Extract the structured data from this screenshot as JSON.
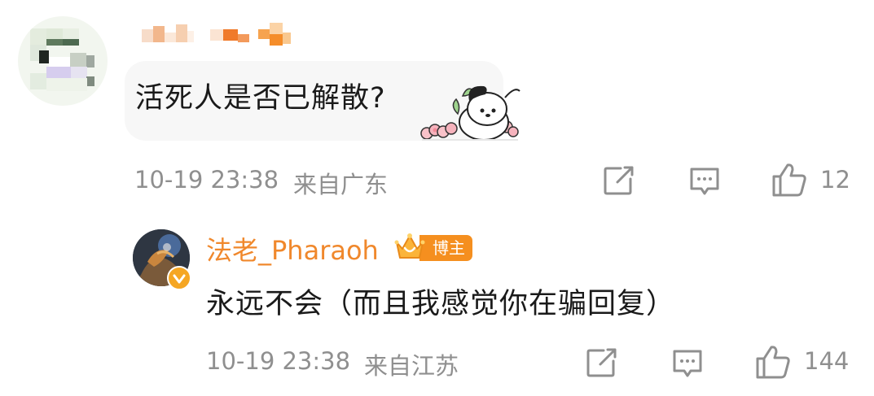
{
  "comment": {
    "username": "",
    "text": "活死人是否已解散?",
    "time": "10-19 23:38",
    "location": "来自广东",
    "like_count": "12",
    "icons": [
      "share-icon",
      "reply-icon",
      "like-icon"
    ]
  },
  "reply": {
    "username": "法老_Pharaoh",
    "author_badge": "博主",
    "text": "永远不会（而且我感觉你在骗回复）",
    "time": "10-19 23:38",
    "location": "来自江苏",
    "like_count": "144",
    "icons": [
      "share-icon",
      "reply-icon",
      "like-icon"
    ]
  },
  "colors": {
    "text_primary": "#1a1a1a",
    "text_meta": "#8f8f8f",
    "username_accent": "#f0882c",
    "author_badge_bg": "#f58f1f",
    "bubble_bg": "#f7f7f7"
  }
}
